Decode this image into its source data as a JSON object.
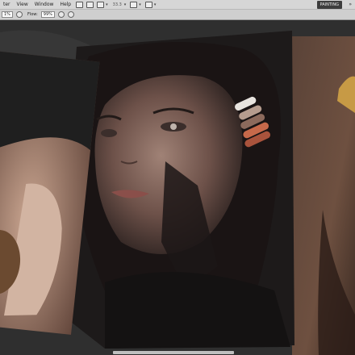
{
  "menubar": {
    "items": [
      "ter",
      "View",
      "Window",
      "Help"
    ],
    "zoom_label": "33.3",
    "workspace_label": "PAINTING"
  },
  "options_bar": {
    "size_value": "1%",
    "flow_label": "Flow:",
    "flow_value": "99%"
  },
  "colors": {
    "chrome": "#d6d6d6",
    "canvas_bg": "#2e2e2e",
    "swatches": [
      "#e8e4df",
      "#b59c8e",
      "#8c6a5c",
      "#c7694a",
      "#a9533c"
    ]
  }
}
